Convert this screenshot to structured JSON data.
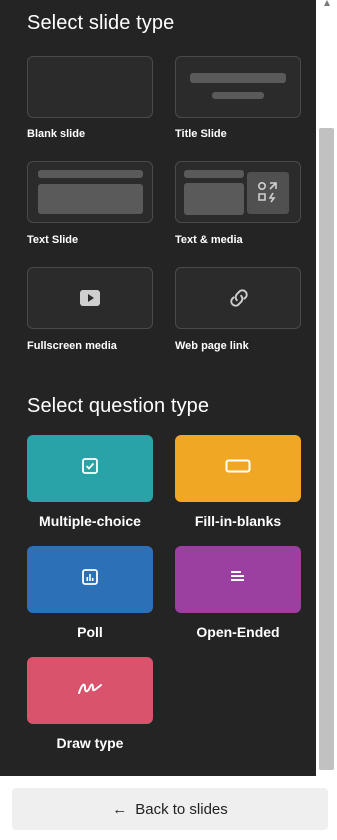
{
  "slide_section": {
    "title": "Select slide type",
    "tiles": [
      {
        "label": "Blank slide",
        "icon": "blank-layout-icon"
      },
      {
        "label": "Title Slide",
        "icon": "title-layout-icon"
      },
      {
        "label": "Text Slide",
        "icon": "text-layout-icon"
      },
      {
        "label": "Text & media",
        "icon": "media-icon"
      },
      {
        "label": "Fullscreen media",
        "icon": "play-icon"
      },
      {
        "label": "Web page link",
        "icon": "link-icon"
      }
    ]
  },
  "question_section": {
    "title": "Select question type",
    "tiles": [
      {
        "label": "Multiple-choice",
        "icon": "checkbox-icon",
        "color": "#2aa3a8"
      },
      {
        "label": "Fill-in-blanks",
        "icon": "blank-field-icon",
        "color": "#f0a824"
      },
      {
        "label": "Poll",
        "icon": "bar-chart-icon",
        "color": "#2c71b8"
      },
      {
        "label": "Open-Ended",
        "icon": "text-lines-icon",
        "color": "#9b3fa0"
      },
      {
        "label": "Draw type",
        "icon": "squiggle-icon",
        "color": "#d9536c"
      }
    ]
  },
  "footer": {
    "back_label": "Back to slides",
    "back_icon": "arrow-left-icon"
  }
}
